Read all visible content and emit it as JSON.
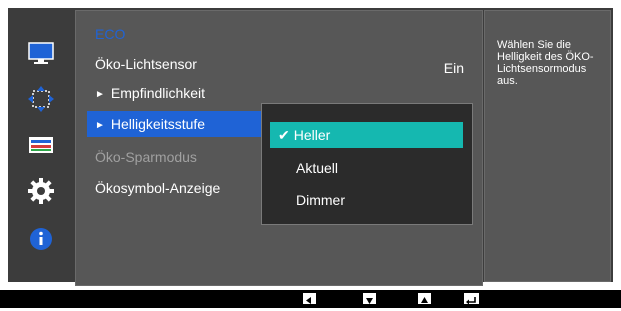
{
  "sidebar": {
    "icons": [
      "monitor-icon",
      "move-arrows-icon",
      "color-settings-icon",
      "gear-icon",
      "info-icon"
    ]
  },
  "menu": {
    "section_title": "ECO",
    "items": [
      {
        "label": "Öko-Lichtsensor",
        "value": "Ein"
      },
      {
        "label": "Empfindlichkeit",
        "marker": "►"
      },
      {
        "label": "Helligkeitsstufe",
        "marker": "►"
      },
      {
        "label": "Öko-Sparmodus"
      },
      {
        "label": "Ökosymbol-Anzeige"
      }
    ]
  },
  "popup": {
    "check": "✔",
    "options": [
      "Heller",
      "Aktuell",
      "Dimmer"
    ]
  },
  "help": {
    "text": "Wählen Sie die Helligkeit des ÖKO-Lichtsensormodus aus."
  },
  "bottom_buttons": [
    "left-arrow-icon",
    "down-arrow-icon",
    "up-arrow-icon",
    "enter-icon"
  ],
  "colors": {
    "accent": "#1f63d6",
    "highlight": "#15b8b0"
  }
}
